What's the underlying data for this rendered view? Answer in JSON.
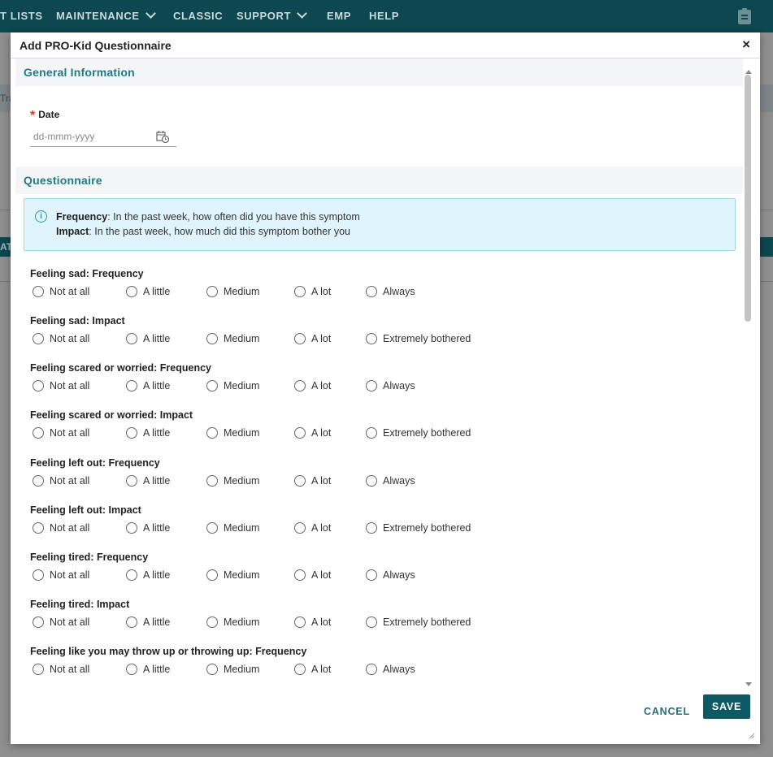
{
  "topnav": {
    "items": [
      {
        "label": "T LISTS",
        "has_menu": false
      },
      {
        "label": "MAINTENANCE",
        "has_menu": true
      },
      {
        "label": "CLASSIC",
        "has_menu": false
      },
      {
        "label": "SUPPORT",
        "has_menu": true
      },
      {
        "label": "EMP",
        "has_menu": false
      },
      {
        "label": "HELP",
        "has_menu": false
      }
    ],
    "right_icon": "clipboard-icon"
  },
  "background": {
    "strip1_text": "Tra",
    "strip2_text": "ATI"
  },
  "dialog": {
    "title": "Add PRO-Kid Questionnaire",
    "close_label": "×",
    "general_section": {
      "title": "General Information",
      "date_label": "Date",
      "date_required_mark": "*",
      "date_value": "",
      "date_placeholder": "dd-mmm-yyyy",
      "date_icon": "calendar-clock-icon"
    },
    "questionnaire_section": {
      "title": "Questionnaire",
      "info": {
        "icon": "info-icon",
        "frequency_term": "Frequency",
        "frequency_text": ": In the past week, how often did you have this symptom",
        "impact_term": "Impact",
        "impact_text": ": In the past week, how much did this symptom bother you"
      },
      "frequency_options": [
        "Not at all",
        "A little",
        "Medium",
        "A lot",
        "Always"
      ],
      "impact_options": [
        "Not at all",
        "A little",
        "Medium",
        "A lot",
        "Extremely bothered"
      ],
      "questions": [
        {
          "label": "Feeling sad: Frequency",
          "kind": "frequency",
          "selected": null
        },
        {
          "label": "Feeling sad: Impact",
          "kind": "impact",
          "selected": null
        },
        {
          "label": "Feeling scared or worried: Frequency",
          "kind": "frequency",
          "selected": null
        },
        {
          "label": "Feeling scared or worried: Impact",
          "kind": "impact",
          "selected": null
        },
        {
          "label": "Feeling left out: Frequency",
          "kind": "frequency",
          "selected": null
        },
        {
          "label": "Feeling left out: Impact",
          "kind": "impact",
          "selected": null
        },
        {
          "label": "Feeling tired: Frequency",
          "kind": "frequency",
          "selected": null
        },
        {
          "label": "Feeling tired: Impact",
          "kind": "impact",
          "selected": null
        },
        {
          "label": "Feeling like you may throw up or throwing up: Frequency",
          "kind": "frequency",
          "selected": null
        }
      ]
    },
    "footer": {
      "cancel_label": "CANCEL",
      "save_label": "SAVE"
    }
  },
  "colors": {
    "nav_bg": "#0d4750",
    "section_title": "#1f7b85",
    "primary_button": "#0d5a64",
    "required": "#d23c2b",
    "info_bg": "#dff4fc"
  }
}
